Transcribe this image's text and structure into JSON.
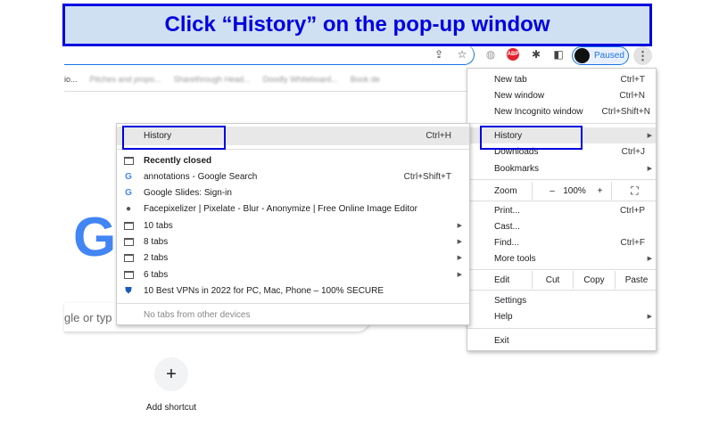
{
  "banner": {
    "text": "Click “History” on the pop-up window"
  },
  "toolbar": {
    "icons": [
      "share-icon",
      "star-icon",
      "globe-icon",
      "adblock-icon",
      "extensions-icon",
      "side-panel-icon"
    ],
    "abp": "ABP",
    "profile_label": "Paused"
  },
  "bookmarks": [
    "io...",
    "Pitches and propo...",
    "Sharethrough Head...",
    "Doodly Whiteboard...",
    "Book de"
  ],
  "main_menu": {
    "new_tab": {
      "label": "New tab",
      "shortcut": "Ctrl+T"
    },
    "new_window": {
      "label": "New window",
      "shortcut": "Ctrl+N"
    },
    "incognito": {
      "label": "New Incognito window",
      "shortcut": "Ctrl+Shift+N"
    },
    "history": {
      "label": "History"
    },
    "downloads": {
      "label": "Downloads",
      "shortcut": "Ctrl+J"
    },
    "bookmarks": {
      "label": "Bookmarks"
    },
    "zoom": {
      "label": "Zoom",
      "minus": "–",
      "value": "100%",
      "plus": "+"
    },
    "print": {
      "label": "Print...",
      "shortcut": "Ctrl+P"
    },
    "cast": {
      "label": "Cast..."
    },
    "find": {
      "label": "Find...",
      "shortcut": "Ctrl+F"
    },
    "more_tools": {
      "label": "More tools"
    },
    "edit": {
      "label": "Edit",
      "cut": "Cut",
      "copy": "Copy",
      "paste": "Paste"
    },
    "settings": {
      "label": "Settings"
    },
    "help": {
      "label": "Help"
    },
    "exit": {
      "label": "Exit"
    }
  },
  "history_menu": {
    "history": {
      "label": "History",
      "shortcut": "Ctrl+H"
    },
    "recently_closed": "Recently closed",
    "items": [
      {
        "label": "annotations - Google Search",
        "shortcut": "Ctrl+Shift+T",
        "icon": "google"
      },
      {
        "label": "Google Slides: Sign-in",
        "icon": "google"
      },
      {
        "label": "Facepixelizer | Pixelate - Blur - Anonymize | Free Online Image Editor",
        "icon": "globe"
      },
      {
        "label": "10 tabs",
        "icon": "tab",
        "submenu": true
      },
      {
        "label": "8 tabs",
        "icon": "tab",
        "submenu": true
      },
      {
        "label": "2 tabs",
        "icon": "tab",
        "submenu": true
      },
      {
        "label": "6 tabs",
        "icon": "tab",
        "submenu": true
      },
      {
        "label": "10 Best VPNs in 2022 for PC, Mac,  Phone – 100% SECURE",
        "icon": "shield"
      }
    ],
    "no_tabs": "No tabs from other devices"
  },
  "page": {
    "google_letter": "G",
    "search_placeholder": "gle or typ",
    "add_shortcut": "Add shortcut",
    "plus": "+"
  },
  "colors": {
    "annotation": "#0000e0",
    "banner_bg": "#cfe0f3",
    "accent": "#1a73e8"
  }
}
